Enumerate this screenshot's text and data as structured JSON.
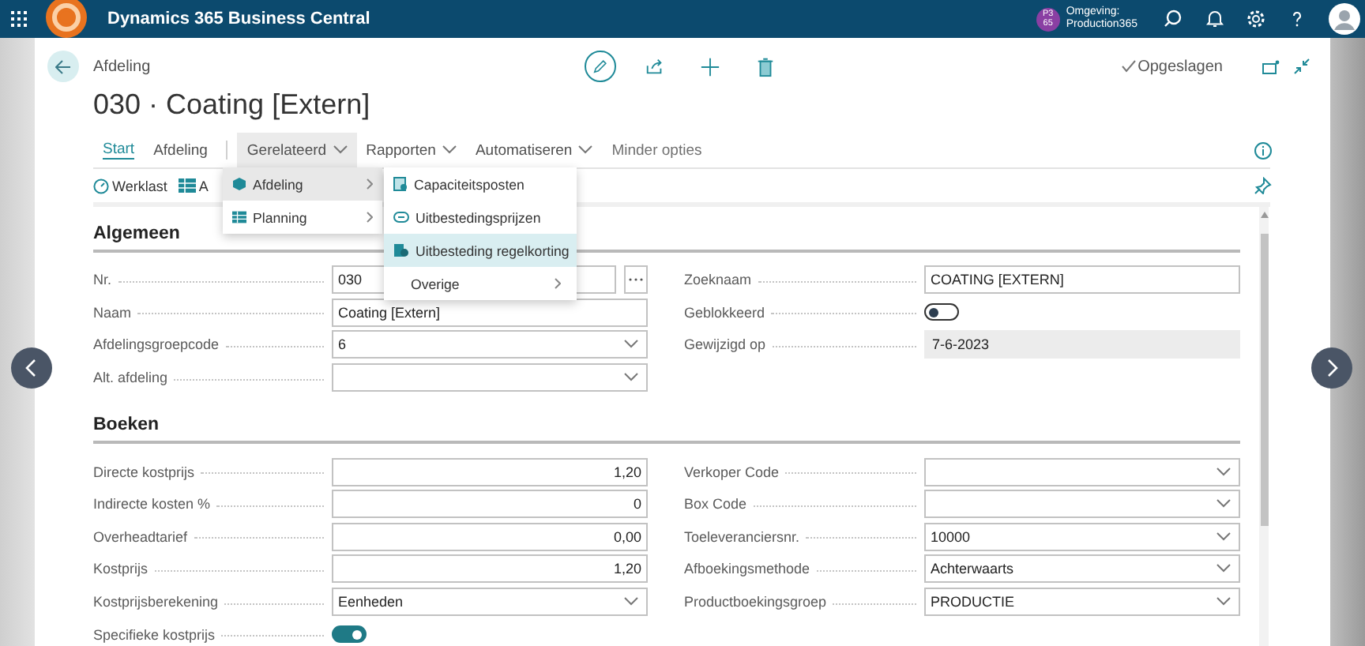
{
  "app_bar": {
    "title": "Dynamics 365 Business Central",
    "environment_badge": "P3 65",
    "environment_label": "Omgeving:",
    "environment_name": "Production365"
  },
  "page": {
    "breadcrumb": "Afdeling",
    "title": "030 · Coating [Extern]",
    "status": "Opgeslagen"
  },
  "tabs": [
    {
      "label": "Start",
      "kind": "page",
      "selected": true,
      "expanded": false
    },
    {
      "label": "Afdeling",
      "kind": "page",
      "selected": false,
      "expanded": false
    },
    {
      "label": "Gerelateerd",
      "kind": "menu",
      "selected": false,
      "expanded": true
    },
    {
      "label": "Rapporten",
      "kind": "menu",
      "selected": false,
      "expanded": false
    },
    {
      "label": "Automatiseren",
      "kind": "menu",
      "selected": false,
      "expanded": false
    },
    {
      "label": "Minder opties",
      "kind": "more",
      "selected": false,
      "expanded": false
    }
  ],
  "actions": [
    {
      "label": "Werklast"
    },
    {
      "label": "A"
    }
  ],
  "menu": {
    "items": [
      {
        "label": "Afdeling",
        "selected": true
      },
      {
        "label": "Planning",
        "selected": false
      }
    ],
    "submenu": [
      {
        "label": "Capaciteitsposten",
        "kind": "action",
        "selected": false
      },
      {
        "label": "Uitbestedingsprijzen",
        "kind": "action",
        "selected": false
      },
      {
        "label": "Uitbesteding regelkorting",
        "kind": "action",
        "selected": true
      },
      {
        "label": "Overige",
        "kind": "submenu",
        "selected": false
      }
    ]
  },
  "sections": [
    {
      "title": "Algemeen",
      "left": [
        {
          "label": "Nr.",
          "kind": "lookup",
          "value": "030"
        },
        {
          "label": "Naam",
          "kind": "text",
          "value": "Coating [Extern]"
        },
        {
          "label": "Afdelingsgroepcode",
          "kind": "select",
          "value": "6"
        },
        {
          "label": "Alt. afdeling",
          "kind": "select"
        }
      ],
      "right": [
        {
          "label": "Zoeknaam",
          "kind": "text",
          "value": "COATING [EXTERN]"
        },
        {
          "label": "Geblokkeerd",
          "kind": "toggle",
          "on": false
        },
        {
          "label": "Gewijzigd op",
          "kind": "readonly",
          "value": "7-6-2023"
        }
      ]
    },
    {
      "title": "Boeken",
      "left": [
        {
          "label": "Directe kostprijs",
          "kind": "number",
          "value": "1,20"
        },
        {
          "label": "Indirecte kosten %",
          "kind": "number",
          "value": "0"
        },
        {
          "label": "Overheadtarief",
          "kind": "number",
          "value": "0,00"
        },
        {
          "label": "Kostprijs",
          "kind": "number",
          "value": "1,20"
        },
        {
          "label": "Kostprijsberekening",
          "kind": "select",
          "value": "Eenheden"
        },
        {
          "label": "Specifieke kostprijs",
          "kind": "toggle",
          "on": true
        }
      ],
      "right": [
        {
          "label": "Verkoper Code",
          "kind": "select"
        },
        {
          "label": "Box Code",
          "kind": "select"
        },
        {
          "label": "Toeleveranciersnr.",
          "kind": "select",
          "value": "10000"
        },
        {
          "label": "Afboekingsmethode",
          "kind": "select",
          "value": "Achterwaarts"
        },
        {
          "label": "Productboekingsgroep",
          "kind": "select",
          "value": "PRODUCTIE"
        }
      ]
    }
  ]
}
